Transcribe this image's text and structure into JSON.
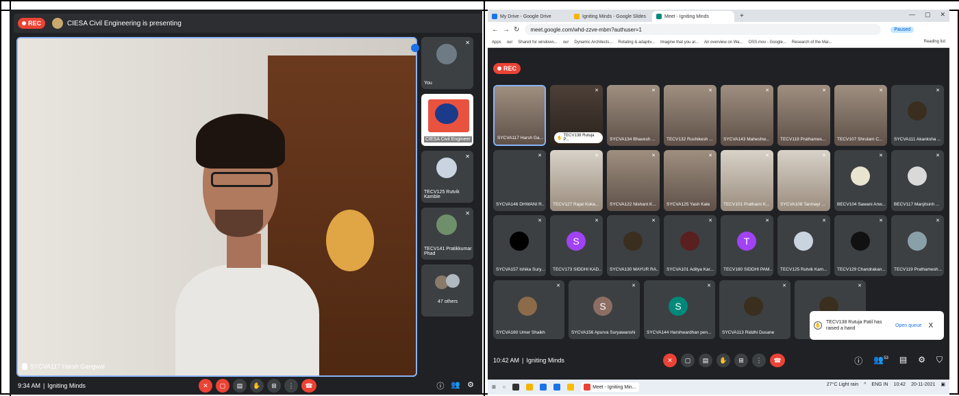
{
  "left": {
    "rec_label": "REC",
    "presenting_text": "CIESA Civil Engineering is presenting",
    "main_speaker_name": "SYCVA117 Harsh Gangwal",
    "side_tiles": [
      {
        "label": "You"
      },
      {
        "label": "CIESA Civil Engineer"
      },
      {
        "label": "TECV125 Rutvik Kamble"
      },
      {
        "label": "TECV141 Pratikkumar Phad"
      },
      {
        "label": "47 others"
      }
    ],
    "bottom": {
      "time": "9:34 AM",
      "separator": "|",
      "meeting_name": "Igniting Minds"
    }
  },
  "right": {
    "browser": {
      "tabs": [
        {
          "label": "My Drive - Google Drive",
          "color": "#1a73e8"
        },
        {
          "label": "Igniting Minds - Google Slides",
          "color": "#f4b400"
        },
        {
          "label": "Meet - Igniting Minds",
          "color": "#00897b"
        }
      ],
      "url": "meet.google.com/whd-zzve-mbm?authuser=1",
      "paused": "Paused",
      "bookmarks": [
        "Apps",
        "our",
        "Shareit for windows...",
        "our",
        "Dynamic Architects...",
        "Rotating & adaptiv...",
        "Imagine that you ar...",
        "An overview on Wa...",
        "OSS.mov - Google...",
        "Research of the Mai..."
      ],
      "reading_list": "Reading list"
    },
    "rec_label": "REC",
    "grid": [
      [
        "SYCVA117 Harsh Ga...",
        "TECV138 Rutuja P...",
        "SYCVA134 Bhavesh ...",
        "TECV132 Rushikesh ...",
        "SYCVA143 Maheshw...",
        "TECV119 Prathames...",
        "TECV107 Shrutam C...",
        "SYCVA111 Akanksha ..."
      ],
      [
        "SYCVA146 DHWANI R...",
        "TECV127 Rajat Koka...",
        "SYCVA122 Nishant K...",
        "SYCVA125 Yash Kale",
        "TECV101 Prathami K...",
        "SYCVA108 Tanmayi ...",
        "BECV104 Sawani Anw...",
        "BECV117 Manjitsinh ..."
      ],
      [
        "SYCVA157 Ishika Sury...",
        "TECV173 SIDDHI KAD...",
        "SYCVA130 MAYUR RA...",
        "SYCVA101 Aditya Kar...",
        "TECV180 SIDDHI PAM...",
        "TECV125 Rutvik Kam...",
        "TECV129 Chandrakan...",
        "TECV119 Prathamesh..."
      ],
      [
        "SYCVA160 Umer Shaikh",
        "SYCVA156 Apurva Suryawanshi",
        "SYCVA144 Harshwardhan pen...",
        "SYCVA113 Riddhi Dusane",
        "",
        ""
      ]
    ],
    "letters": {
      "s1": "S",
      "t1": "T",
      "s2": "S",
      "s3": "S"
    },
    "toast": {
      "text": "TECV138 Rutuja Patil has raised a hand",
      "open_queue": "Open queue",
      "close": "X"
    },
    "bottom": {
      "time": "10:42 AM",
      "separator": "|",
      "meeting_name": "Igniting Minds",
      "people_count": "53"
    },
    "taskbar": {
      "app_label": "Meet - Igniting Min...",
      "weather": "27°C Light rain",
      "lang": "ENG IN",
      "clock": "10:42",
      "date": "20-11-2021"
    }
  },
  "colors": {
    "rec": "#ea4335",
    "accent": "#8ab4f8",
    "tile_bg": "#3c4043",
    "meet_bg": "#202124"
  }
}
